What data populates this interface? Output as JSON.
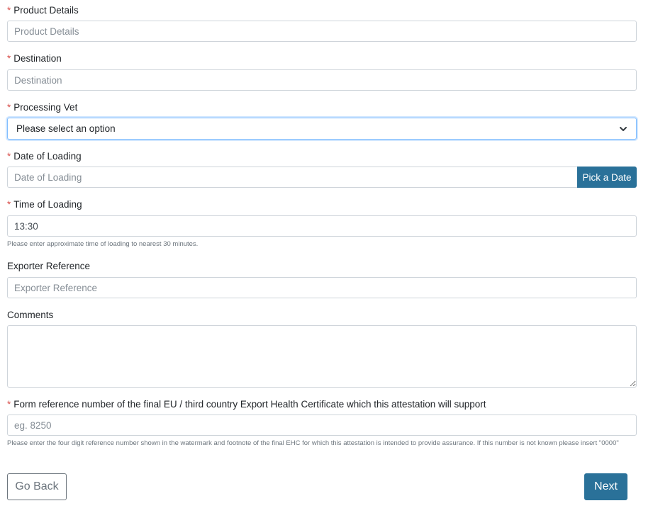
{
  "required_marker": "*",
  "fields": {
    "product_details": {
      "label": "Product Details",
      "placeholder": "Product Details",
      "value": ""
    },
    "destination": {
      "label": "Destination",
      "placeholder": "Destination",
      "value": ""
    },
    "processing_vet": {
      "label": "Processing Vet",
      "selected": "Please select an option"
    },
    "date_of_loading": {
      "label": "Date of Loading",
      "placeholder": "Date of Loading",
      "value": "",
      "button_label": "Pick a Date"
    },
    "time_of_loading": {
      "label": "Time of Loading",
      "value": "13:30",
      "help": "Please enter approximate time of loading to nearest 30 minutes."
    },
    "exporter_reference": {
      "label": "Exporter Reference",
      "placeholder": "Exporter Reference",
      "value": ""
    },
    "comments": {
      "label": "Comments",
      "value": ""
    },
    "form_reference": {
      "label": "Form reference number of the final EU / third country Export Health Certificate which this attestation will support",
      "placeholder": "eg. 8250",
      "value": "",
      "help": "Please enter the four digit reference number shown in the watermark and footnote of the final EHC for which this attestation is intended to provide assurance. If this number is not known please insert \"0000\""
    }
  },
  "buttons": {
    "back_label": "Go Back",
    "next_label": "Next"
  },
  "colors": {
    "primary": "#2a7199",
    "required": "#d9534f",
    "focus_border": "#80bdff"
  }
}
